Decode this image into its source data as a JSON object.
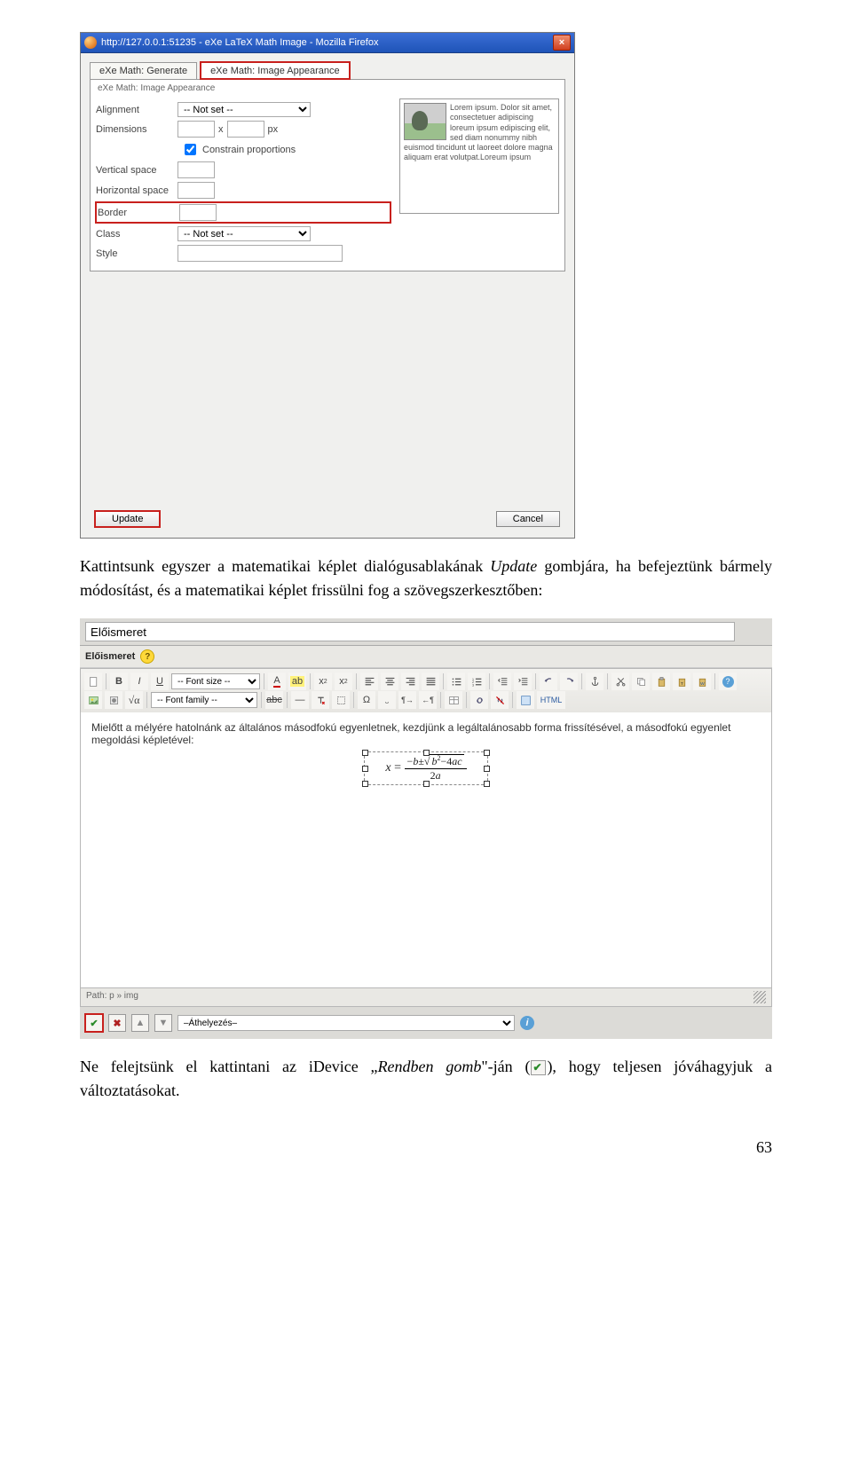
{
  "ff": {
    "title": "http://127.0.0.1:51235 - eXe LaTeX Math Image - Mozilla Firefox",
    "tab1": "eXe Math: Generate",
    "tab2": "eXe Math: Image Appearance",
    "panel_title": "eXe Math: Image Appearance",
    "alignment_label": "Alignment",
    "alignment_value": "-- Not set --",
    "dimensions_label": "Dimensions",
    "dim_sep": "x",
    "dim_unit": "px",
    "constrain": "Constrain proportions",
    "vspace_label": "Vertical space",
    "hspace_label": "Horizontal space",
    "border_label": "Border",
    "class_label": "Class",
    "class_value": "-- Not set --",
    "style_label": "Style",
    "preview_text": "Lorem ipsum. Dolor sit amet, consectetuer adipiscing loreum ipsum edipiscing elit, sed diam nonummy nibh euismod tincidunt ut laoreet dolore magna aliquam erat volutpat.Loreum ipsum",
    "update": "Update",
    "cancel": "Cancel"
  },
  "para1": "Kattintsunk egyszer a matematikai képlet dialógusablakának ",
  "para1_em": "Update",
  "para1_b": " gombjára, ha befejeztünk bármely módosítást, és a matematikai képlet frissülni fog a szövegszerkesztőben:",
  "editor": {
    "title_field": "Előismeret",
    "label": "Előismeret",
    "font_size": "-- Font size --",
    "font_family": "-- Font family --",
    "content_text": "Mielőtt a mélyére hatolnánk az általános másodfokú egyenletnek, kezdjünk a legáltalánosabb forma frissítésével, a másodfokú egyenlet megoldási képletével:",
    "status": "Path: p » img",
    "move_select": "–Áthelyezés–",
    "html_label": "HTML"
  },
  "para2_a": "Ne felejtsünk el kattintani az iDevice „",
  "para2_em": "Rendben gomb",
  "para2_b": "\"-ján (",
  "para2_c": "), hogy teljesen jóváhagyjuk a változtatásokat.",
  "page_number": "63"
}
